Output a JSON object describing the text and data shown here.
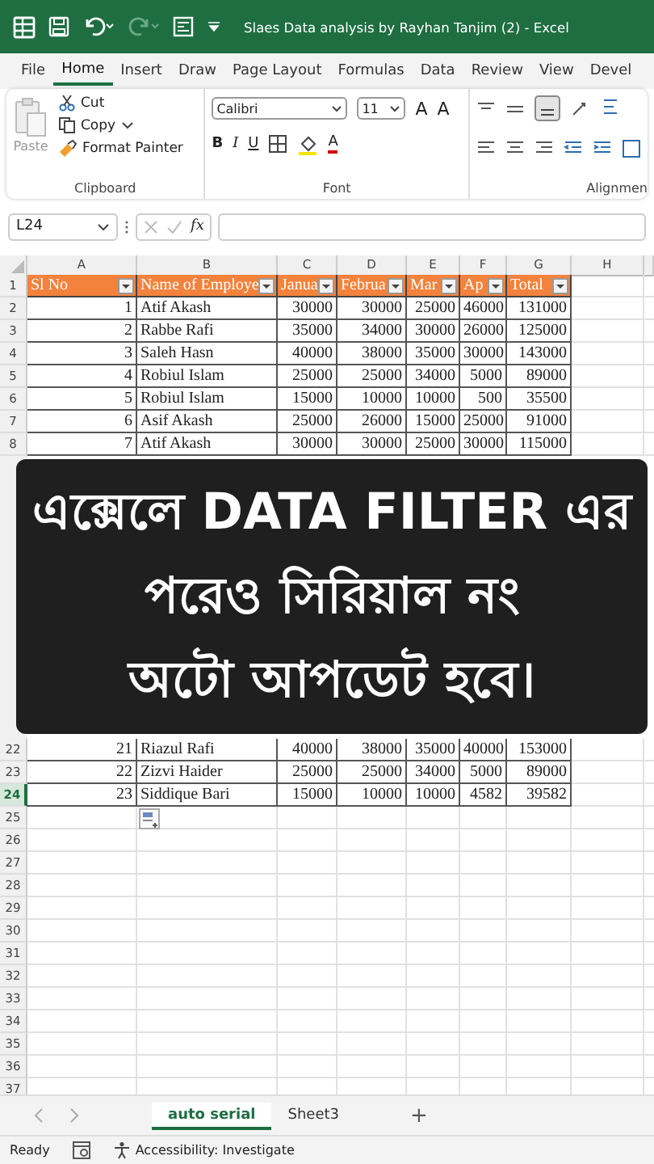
{
  "title_bar": {
    "title": "Slaes Data analysis by Rayhan Tanjim (2)  -  Excel"
  },
  "menu_tabs": [
    {
      "label": "File",
      "selected": false
    },
    {
      "label": "Home",
      "selected": true
    },
    {
      "label": "Insert",
      "selected": false
    },
    {
      "label": "Draw",
      "selected": false
    },
    {
      "label": "Page Layout",
      "selected": false
    },
    {
      "label": "Formulas",
      "selected": false
    },
    {
      "label": "Data",
      "selected": false
    },
    {
      "label": "Review",
      "selected": false
    },
    {
      "label": "View",
      "selected": false
    },
    {
      "label": "Devel",
      "selected": false
    }
  ],
  "ribbon": {
    "clipboard": {
      "paste": "Paste",
      "cut": "Cut",
      "copy": "Copy",
      "format_painter": "Format Painter",
      "label": "Clipboard"
    },
    "font": {
      "font_name": "Calibri",
      "font_size": "11",
      "grow": "A",
      "shrink": "A",
      "bold": "B",
      "italic": "I",
      "underline": "U",
      "font_color": "A",
      "label": "Font"
    },
    "alignment": {
      "label": "Alignmen"
    }
  },
  "formula_bar": {
    "name_box": "L24",
    "fx": "fx"
  },
  "columns": [
    "A",
    "B",
    "C",
    "D",
    "E",
    "F",
    "G",
    "H"
  ],
  "rows_top": [
    {
      "n": "1",
      "kind": "header",
      "active": false,
      "cells": [
        "Sl No",
        "Name of Employe",
        "Janua",
        "Februa",
        "Mar",
        "Ap",
        "Total"
      ]
    },
    {
      "n": "2",
      "kind": "data",
      "active": false,
      "cells": [
        "1",
        "Atif Akash",
        "30000",
        "30000",
        "25000",
        "46000",
        "131000"
      ]
    },
    {
      "n": "3",
      "kind": "data",
      "active": false,
      "cells": [
        "2",
        "Rabbe Rafi",
        "35000",
        "34000",
        "30000",
        "26000",
        "125000"
      ]
    },
    {
      "n": "4",
      "kind": "data",
      "active": false,
      "cells": [
        "3",
        "Saleh Hasn",
        "40000",
        "38000",
        "35000",
        "30000",
        "143000"
      ]
    },
    {
      "n": "5",
      "kind": "data",
      "active": false,
      "cells": [
        "4",
        "Robiul Islam",
        "25000",
        "25000",
        "34000",
        "5000",
        "89000"
      ]
    },
    {
      "n": "6",
      "kind": "data",
      "active": false,
      "cells": [
        "5",
        "Robiul Islam",
        "15000",
        "10000",
        "10000",
        "500",
        "35500"
      ]
    },
    {
      "n": "7",
      "kind": "data",
      "active": false,
      "cells": [
        "6",
        "Asif Akash",
        "25000",
        "26000",
        "15000",
        "25000",
        "91000"
      ]
    },
    {
      "n": "8",
      "kind": "data",
      "active": false,
      "cells": [
        "7",
        "Atif Akash",
        "30000",
        "30000",
        "25000",
        "30000",
        "115000"
      ]
    }
  ],
  "banner": [
    "এক্সেলে DATA FILTER এর",
    "পরেও সিরিয়াল নং",
    "অটো আপডেট হবে।"
  ],
  "rows_bottom": [
    {
      "n": "22",
      "kind": "data",
      "active": false,
      "cells": [
        "21",
        "Riazul Rafi",
        "40000",
        "38000",
        "35000",
        "40000",
        "153000"
      ]
    },
    {
      "n": "23",
      "kind": "data",
      "active": false,
      "cells": [
        "22",
        "Zizvi Haider",
        "25000",
        "25000",
        "34000",
        "5000",
        "89000"
      ]
    },
    {
      "n": "24",
      "kind": "data",
      "active": true,
      "cells": [
        "23",
        "Siddique Bari",
        "15000",
        "10000",
        "10000",
        "4582",
        "39582"
      ]
    },
    {
      "n": "25",
      "kind": "blank",
      "active": false
    },
    {
      "n": "26",
      "kind": "blank",
      "active": false
    },
    {
      "n": "27",
      "kind": "blank",
      "active": false
    },
    {
      "n": "28",
      "kind": "blank",
      "active": false
    },
    {
      "n": "29",
      "kind": "blank",
      "active": false
    },
    {
      "n": "30",
      "kind": "blank",
      "active": false
    },
    {
      "n": "31",
      "kind": "blank",
      "active": false
    },
    {
      "n": "32",
      "kind": "blank",
      "active": false
    },
    {
      "n": "33",
      "kind": "blank",
      "active": false
    },
    {
      "n": "34",
      "kind": "blank",
      "active": false
    },
    {
      "n": "35",
      "kind": "blank",
      "active": false
    },
    {
      "n": "36",
      "kind": "blank",
      "active": false
    },
    {
      "n": "37",
      "kind": "blank",
      "active": false
    }
  ],
  "sheet_tabs": [
    {
      "label": "auto serial",
      "selected": true
    },
    {
      "label": "Sheet3",
      "selected": false
    }
  ],
  "add_sheet": "+",
  "status_bar": {
    "ready": "Ready",
    "accessibility": "Accessibility: Investigate"
  }
}
